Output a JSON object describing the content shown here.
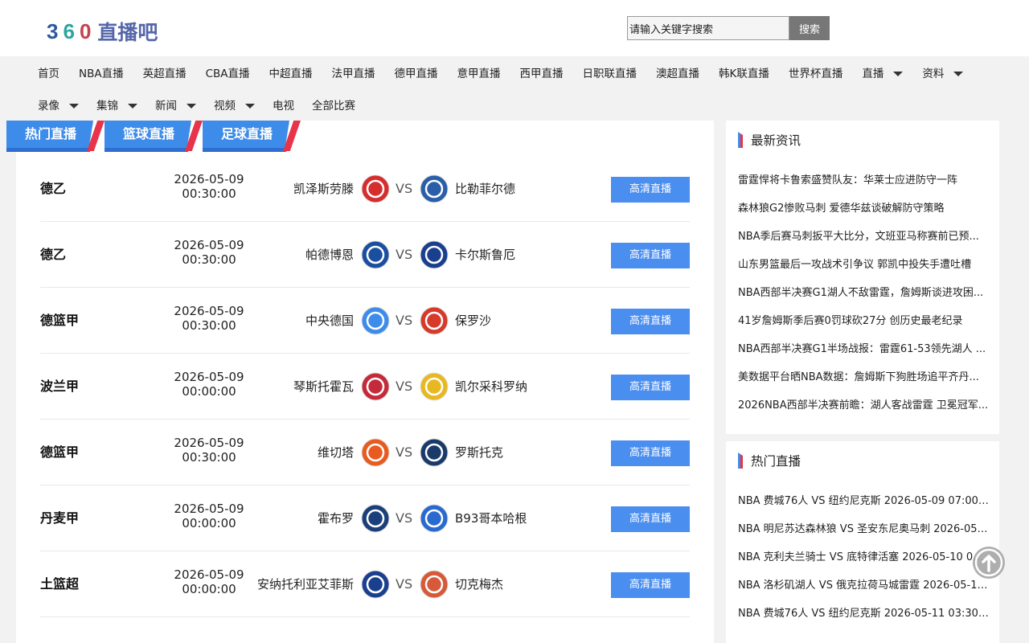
{
  "logo": {
    "digit1": "3",
    "digit2": "6",
    "digit3": "0",
    "chinese": "直播吧"
  },
  "search": {
    "value": "请输入关键字搜索",
    "button": "搜索"
  },
  "nav": {
    "row1": [
      {
        "label": "首页",
        "caret": false
      },
      {
        "label": "NBA直播",
        "caret": false
      },
      {
        "label": "英超直播",
        "caret": false
      },
      {
        "label": "CBA直播",
        "caret": false
      },
      {
        "label": "中超直播",
        "caret": false
      },
      {
        "label": "法甲直播",
        "caret": false
      },
      {
        "label": "德甲直播",
        "caret": false
      },
      {
        "label": "意甲直播",
        "caret": false
      },
      {
        "label": "西甲直播",
        "caret": false
      },
      {
        "label": "日职联直播",
        "caret": false
      },
      {
        "label": "澳超直播",
        "caret": false
      },
      {
        "label": "韩K联直播",
        "caret": false
      },
      {
        "label": "世界杯直播",
        "caret": false
      },
      {
        "label": "直播",
        "caret": true
      },
      {
        "label": "资料",
        "caret": true
      }
    ],
    "row2": [
      {
        "label": "录像",
        "caret": true
      },
      {
        "label": "集锦",
        "caret": true
      },
      {
        "label": "新闻",
        "caret": true
      },
      {
        "label": "视频",
        "caret": true
      },
      {
        "label": "电视",
        "caret": false
      },
      {
        "label": "全部比赛",
        "caret": false
      }
    ]
  },
  "tabs": [
    "热门直播",
    "篮球直播",
    "足球直播"
  ],
  "matches": [
    {
      "league": "德乙",
      "date": "2026-05-09",
      "time": "00:30:00",
      "home": "凯泽斯劳滕",
      "away": "比勒菲尔德",
      "vs": "VS",
      "button": "高清直播",
      "home_color": "#d62d2d",
      "away_color": "#2a5ea8"
    },
    {
      "league": "德乙",
      "date": "2026-05-09",
      "time": "00:30:00",
      "home": "帕德博恩",
      "away": "卡尔斯鲁厄",
      "vs": "VS",
      "button": "高清直播",
      "home_color": "#1a4fa0",
      "away_color": "#1a3f8f"
    },
    {
      "league": "德篮甲",
      "date": "2026-05-09",
      "time": "00:30:00",
      "home": "中央德国",
      "away": "保罗沙",
      "vs": "VS",
      "button": "高清直播",
      "home_color": "#3d8ce9",
      "away_color": "#d63a2a"
    },
    {
      "league": "波兰甲",
      "date": "2026-05-09",
      "time": "00:00:00",
      "home": "琴斯托霍瓦",
      "away": "凯尔采科罗纳",
      "vs": "VS",
      "button": "高清直播",
      "home_color": "#c42a3a",
      "away_color": "#e8b820"
    },
    {
      "league": "德篮甲",
      "date": "2026-05-09",
      "time": "00:30:00",
      "home": "维切塔",
      "away": "罗斯托克",
      "vs": "VS",
      "button": "高清直播",
      "home_color": "#e85a20",
      "away_color": "#1a3a6a"
    },
    {
      "league": "丹麦甲",
      "date": "2026-05-09",
      "time": "00:00:00",
      "home": "霍布罗",
      "away": "B93哥本哈根",
      "vs": "VS",
      "button": "高清直播",
      "home_color": "#1a3f7a",
      "away_color": "#2a6ad0"
    },
    {
      "league": "土篮超",
      "date": "2026-05-09",
      "time": "00:00:00",
      "home": "安纳托利亚艾菲斯",
      "away": "切克梅杰",
      "vs": "VS",
      "button": "高清直播",
      "home_color": "#1a3f8f",
      "away_color": "#d65a3a"
    }
  ],
  "news": {
    "title": "最新资讯",
    "items": [
      "雷霆悍将卡鲁索盛赞队友：华莱士应进防守一阵",
      "森林狼G2惨败马刺 爱德华兹谈破解防守策略",
      "NBA季后赛马刺扳平大比分，文班亚马称赛前已预...",
      "山东男篮最后一攻战术引争议 郭凯中投失手遭吐槽",
      "NBA西部半决赛G1湖人不敌雷霆，詹姆斯谈进攻困...",
      "41岁詹姆斯季后赛0罚球砍27分 创历史最老纪录",
      "NBA西部半决赛G1半场战报：雷霆61-53领先湖人 ...",
      "美数据平台晒NBA数据：詹姆斯下狗胜场追平齐丹...",
      "2026NBA西部半决赛前瞻：湖人客战雷霆 卫冕冠军..."
    ]
  },
  "hot": {
    "title": "热门直播",
    "items": [
      "NBA 费城76人 VS 纽约尼克斯 2026-05-09 07:00:00",
      "NBA 明尼苏达森林狼 VS 圣安东尼奥马刺 2026-05-...",
      "NBA 克利夫兰骑士 VS 底特律活塞 2026-05-10 03:0...",
      "NBA 洛杉矶湖人 VS 俄克拉荷马城雷霆 2026-05-10 ...",
      "NBA 费城76人 VS 纽约尼克斯 2026-05-11 03:30:00"
    ]
  },
  "colors": {
    "accent_blue": "#3d8ce9",
    "accent_red": "#e8344a",
    "button_blue": "#4a8ef0"
  },
  "icons": {
    "to_top": "arrow-up-circle-icon",
    "caret": "caret-down-icon"
  }
}
